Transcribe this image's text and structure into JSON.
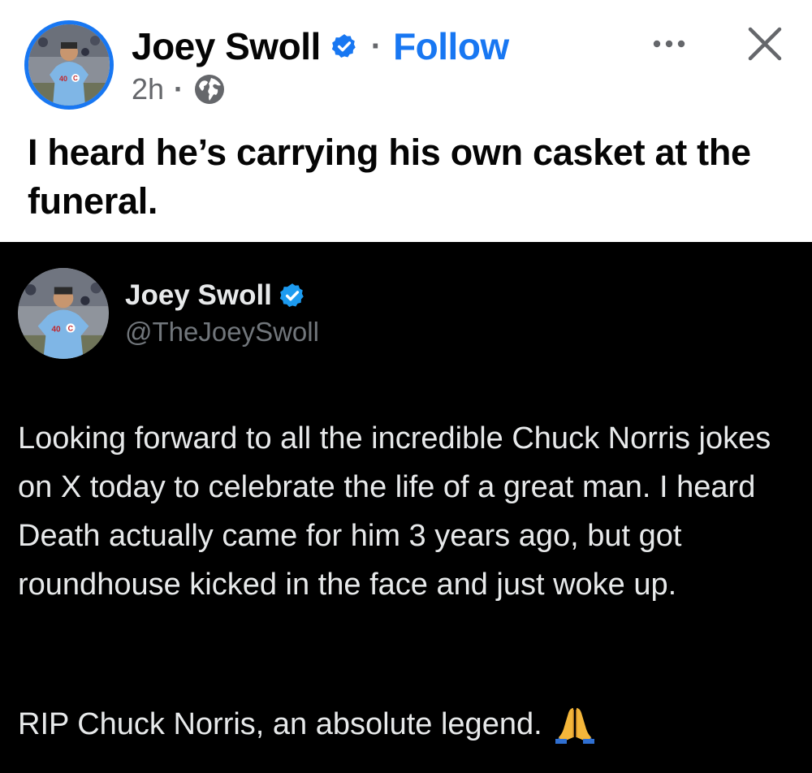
{
  "post": {
    "author_name": "Joey Swoll",
    "separator": "·",
    "follow_label": "Follow",
    "timestamp": "2h",
    "meta_separator": "·",
    "privacy_icon": "globe-icon",
    "more_icon": "more-options-icon",
    "close_icon": "close-icon",
    "text": "I heard he’s carrying his own casket at the funeral."
  },
  "embedded_tweet": {
    "author_name": "Joey Swoll",
    "handle": "@TheJoeySwoll",
    "verified_icon": "verified-badge-icon",
    "body": "Looking forward to all the incredible Chuck Norris jokes on X today to celebrate the life of a great man. I heard Death actually came for him 3 years ago, but got roundhouse kicked in the face and just woke up.",
    "closing_line": "RIP Chuck Norris, an absolute legend.",
    "closing_emoji": "folded-hands-emoji"
  },
  "colors": {
    "accent_blue": "#1877f2",
    "x_verified_blue": "#1d9bf0",
    "tweet_background": "#000000",
    "tweet_text": "#e7e9ea",
    "tweet_muted": "#71767b",
    "post_muted": "#65676b"
  }
}
